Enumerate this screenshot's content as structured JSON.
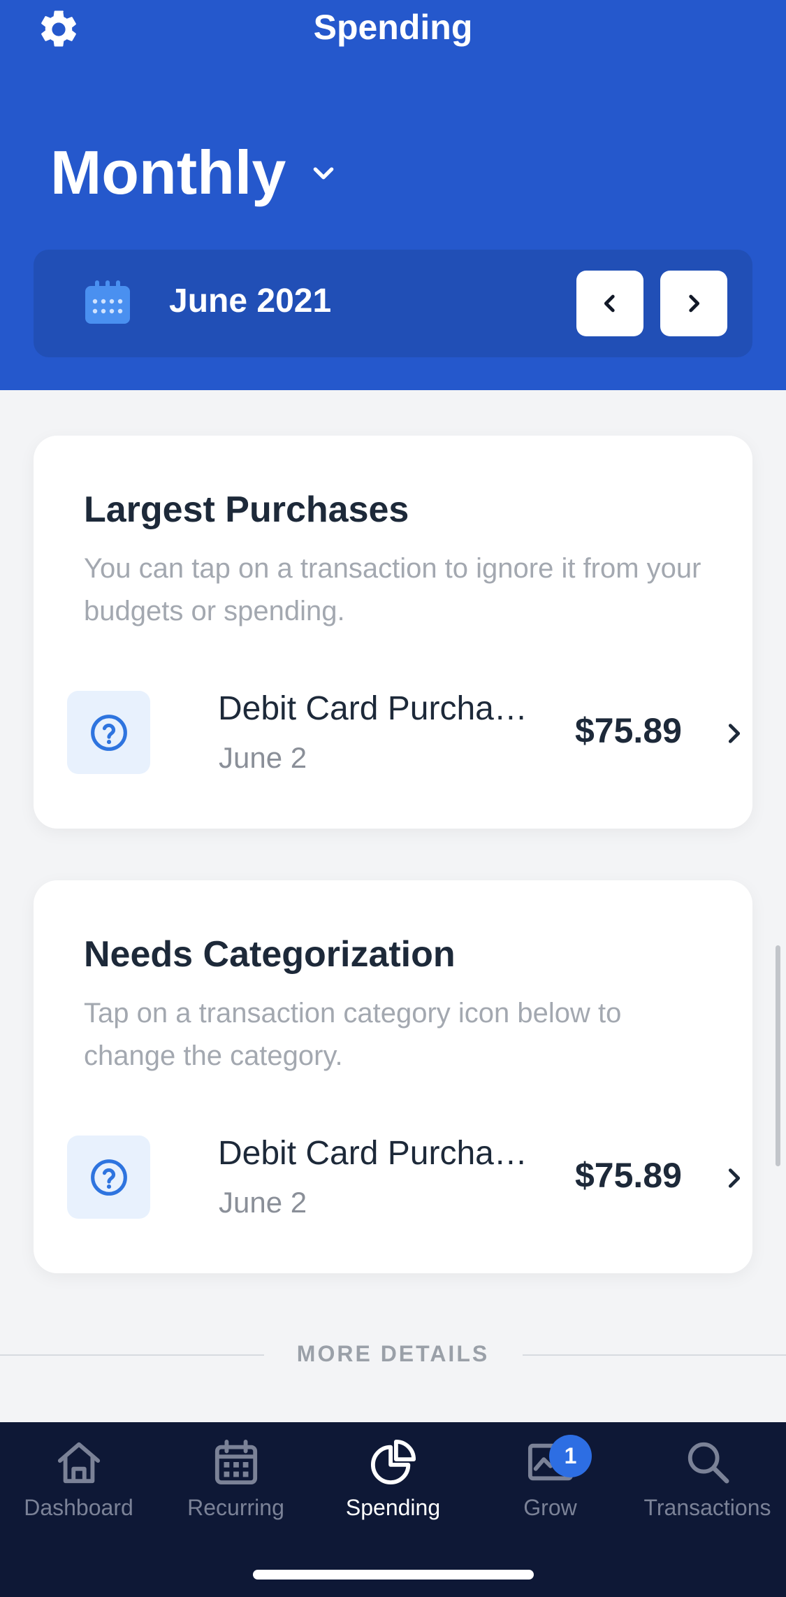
{
  "header": {
    "title": "Spending",
    "period": "Monthly",
    "date_label": "June 2021"
  },
  "cards": {
    "largest": {
      "title": "Largest Purchases",
      "description": "You can tap on a transaction to ignore it from your budgets or spending.",
      "transaction": {
        "name": "Debit Card Purcha…",
        "date": "June 2",
        "amount": "$75.89"
      }
    },
    "needs": {
      "title": "Needs Categorization",
      "description": "Tap on a transaction category icon below to change the category.",
      "transaction": {
        "name": "Debit Card Purcha…",
        "date": "June 2",
        "amount": "$75.89"
      }
    }
  },
  "more_details": "MORE DETAILS",
  "tabbar": {
    "tabs": [
      {
        "label": "Dashboard",
        "icon": "home-icon",
        "active": false
      },
      {
        "label": "Recurring",
        "icon": "calendar-icon",
        "active": false
      },
      {
        "label": "Spending",
        "icon": "pie-chart-icon",
        "active": true
      },
      {
        "label": "Grow",
        "icon": "chart-icon",
        "active": false
      },
      {
        "label": "Transactions",
        "icon": "search-icon",
        "active": false
      }
    ],
    "grow_badge": "1"
  },
  "colors": {
    "header_bg": "#2558cc",
    "tabbar_bg": "#0e1836",
    "accent": "#2d6ee3"
  }
}
